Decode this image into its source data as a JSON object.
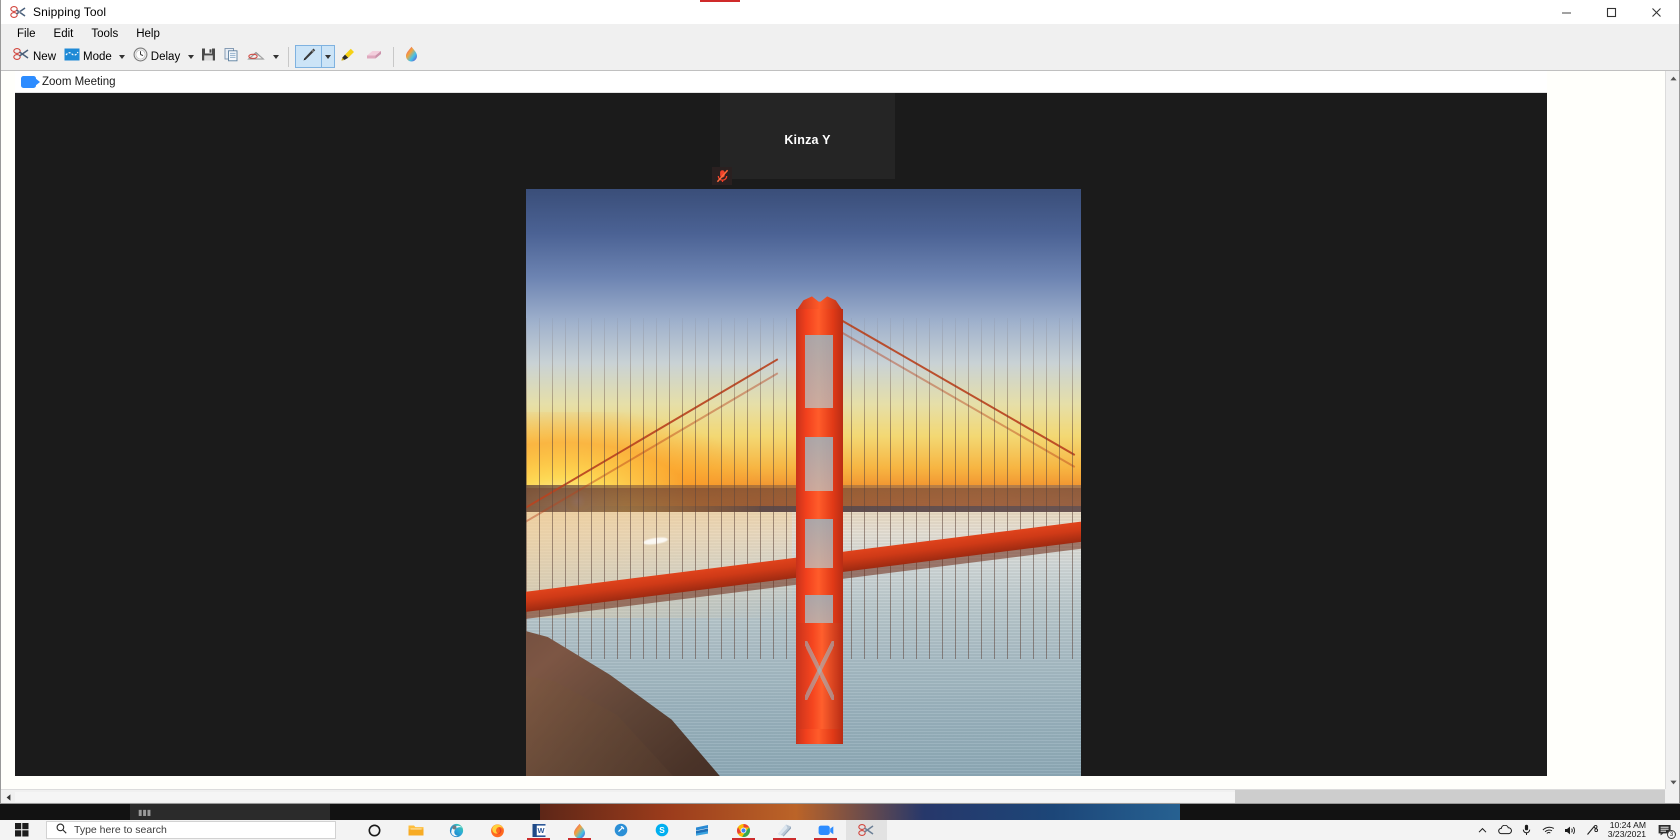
{
  "window": {
    "title": "Snipping Tool",
    "icon": "scissors-icon",
    "controls": {
      "minimize": "minimize-icon",
      "maximize": "maximize-icon",
      "close": "close-icon"
    }
  },
  "menu": {
    "items": [
      "File",
      "Edit",
      "Tools",
      "Help"
    ]
  },
  "toolbar": {
    "new_label": "New",
    "mode_label": "Mode",
    "delay_label": "Delay",
    "save_title": "Save Snip",
    "copy_title": "Copy",
    "email_title": "Send Snip",
    "pen_title": "Pen",
    "highlighter_title": "Highlighter",
    "eraser_title": "Eraser",
    "paint3d_title": "Edit with Paint 3D",
    "selected_tool": "pen"
  },
  "snip": {
    "header_title": "Zoom Meeting",
    "header_icon": "zoom-camera-icon",
    "participant": {
      "name": "Kinza Y",
      "mute_icon": "microphone-muted-icon"
    },
    "shared_image": {
      "description": "Golden Gate Bridge at sunset",
      "sky_top_color": "#3a4e79",
      "sky_horizon_color": "#f7b542",
      "bridge_color": "#ff5c2a",
      "water_color": "#a8bcc4",
      "cliff_color": "#6b4a3c"
    },
    "background_color": "#1b1b1b"
  },
  "scrollbars": {
    "vertical_up": "chevron-up-icon",
    "vertical_down": "chevron-down-icon",
    "horizontal_left": "chevron-left-icon"
  },
  "taskbar": {
    "start_label": "start-button",
    "search_placeholder": "Type here to search",
    "search_icon": "search-icon",
    "items": [
      {
        "name": "cortana",
        "icon": "cortana-circle-icon",
        "running": false
      },
      {
        "name": "file-explorer",
        "icon": "folder-icon",
        "running": false
      },
      {
        "name": "microsoft-edge",
        "icon": "edge-icon",
        "running": false
      },
      {
        "name": "firefox",
        "icon": "firefox-icon",
        "running": false
      },
      {
        "name": "word",
        "icon": "word-icon",
        "running": true
      },
      {
        "name": "paint-3d",
        "icon": "droplet-icon",
        "running": true
      },
      {
        "name": "app-blue",
        "icon": "blue-circle-icon",
        "running": false
      },
      {
        "name": "skype",
        "icon": "skype-icon",
        "running": false
      },
      {
        "name": "microsoft-store",
        "icon": "store-icon",
        "running": false
      },
      {
        "name": "chrome",
        "icon": "chrome-icon",
        "running": true
      },
      {
        "name": "notebook",
        "icon": "notebook-icon",
        "running": true
      },
      {
        "name": "zoom",
        "icon": "zoom-camera-icon",
        "running": true
      },
      {
        "name": "snipping-tool",
        "icon": "scissors-icon",
        "running": true,
        "active": true
      }
    ],
    "tray": {
      "overflow": "chevron-up-icon",
      "onedrive": "cloud-icon",
      "microphone": "microphone-icon",
      "network": "wifi-icon",
      "volume": "speaker-icon",
      "bluetooth_pen": "pen-bluetooth-icon",
      "time": "10:24 AM",
      "date": "3/23/2021",
      "notifications_icon": "action-center-icon",
      "notifications_count": "3"
    }
  }
}
